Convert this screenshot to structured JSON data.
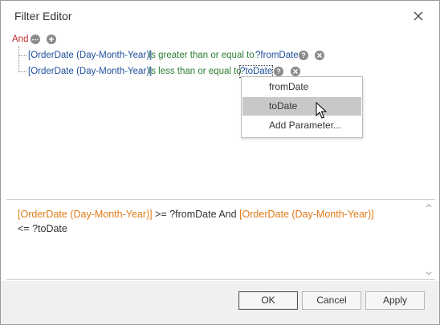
{
  "window": {
    "title": "Filter Editor"
  },
  "tree": {
    "group_operator": "And",
    "conditions": [
      {
        "field": "[OrderDate (Day-Month-Year)]",
        "operator": "Is greater than or equal to",
        "value": "?fromDate"
      },
      {
        "field": "[OrderDate (Day-Month-Year)]",
        "operator": "Is less than or equal to",
        "value": "?toDate"
      }
    ],
    "help_glyph": "?"
  },
  "dropdown": {
    "items": [
      "fromDate",
      "toDate",
      "Add Parameter..."
    ],
    "selected_index": 1
  },
  "expression": {
    "field1": "[OrderDate (Day-Month-Year)]",
    "part1": " >= ?fromDate And ",
    "field2": "[OrderDate (Day-Month-Year)]",
    "part2": "<= ?toDate"
  },
  "buttons": {
    "ok": "OK",
    "cancel": "Cancel",
    "apply": "Apply"
  },
  "icons": {
    "close": "close-icon",
    "ellipsis": "ellipsis-icon",
    "add": "plus-icon",
    "help": "help-icon",
    "remove": "remove-icon",
    "cursor": "mouse-pointer-icon"
  },
  "colors": {
    "group_operator": "#c0272d",
    "field": "#1f4e9c",
    "operator": "#2e7d32",
    "expression_field": "#e07b17",
    "selected_item": "#c8c8c8"
  }
}
